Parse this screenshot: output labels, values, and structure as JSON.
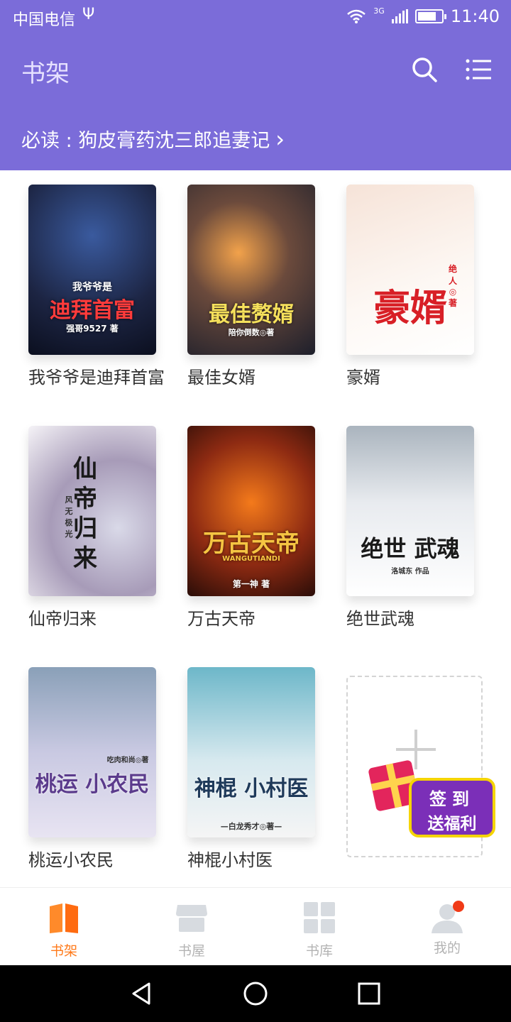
{
  "status_bar": {
    "carrier": "中国电信",
    "usb_symbol": "Ψ",
    "network": "3G",
    "time": "11:40",
    "battery_level": 0.7
  },
  "header": {
    "title": "书架",
    "must_read": "必读 : 狗皮膏药沈三郎追妻记",
    "must_read_arrow": "›",
    "search_icon": "search-icon",
    "menu_icon": "list-menu-icon"
  },
  "books": [
    {
      "name": "我爷爷是迪拜首富",
      "cover_title": "迪拜首富",
      "cover_sub": "我爷爷是",
      "author": "强哥9527 著"
    },
    {
      "name": "最佳女婿",
      "cover_title": "最佳赘婿",
      "cover_sub": "",
      "author": "陪你倒数◎著"
    },
    {
      "name": "豪婿",
      "cover_title": "豪婿",
      "cover_sub": "",
      "author": "绝人◎著"
    },
    {
      "name": "仙帝归来",
      "cover_title": "仙帝归来",
      "cover_sub": "",
      "author": "风无极光"
    },
    {
      "name": "万古天帝",
      "cover_title": "万古天帝",
      "cover_sub": "WANGUTIANDI",
      "author": "第一神 著"
    },
    {
      "name": "绝世武魂",
      "cover_title": "绝世 武魂",
      "cover_sub": "",
      "author": "洛城东 作品"
    },
    {
      "name": "桃运小农民",
      "cover_title": "桃运 小农民",
      "cover_sub": "",
      "author": "吃肉和尚◎著"
    },
    {
      "name": "神棍小村医",
      "cover_title": "神棍 小村医",
      "cover_sub": "",
      "author": "—白龙秀才◎著—"
    }
  ],
  "add_slot": {
    "icon": "plus-icon"
  },
  "signin_promo": {
    "line1": "签到",
    "line2": "送福利"
  },
  "tabbar": {
    "items": [
      {
        "label": "书架",
        "icon": "bookshelf-icon",
        "active": true
      },
      {
        "label": "书屋",
        "icon": "store-icon",
        "active": false
      },
      {
        "label": "书库",
        "icon": "grid-icon",
        "active": false
      },
      {
        "label": "我的",
        "icon": "profile-icon",
        "active": false,
        "badge": true
      }
    ]
  },
  "colors": {
    "header_bg": "#7b6cd9",
    "active_tab": "#ff7a1a",
    "inactive_tab": "#b3b3b3",
    "badge_dot": "#f03a17"
  }
}
